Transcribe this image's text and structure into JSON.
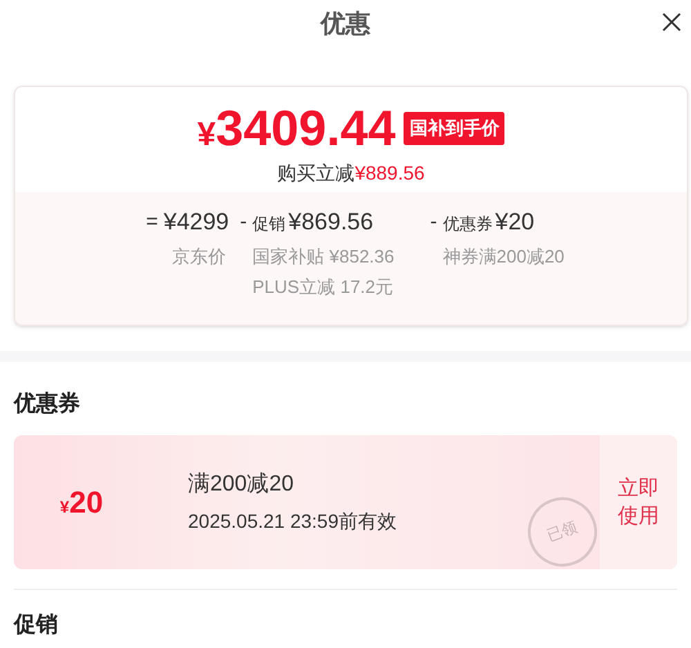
{
  "header": {
    "title": "优惠"
  },
  "summary": {
    "currency": "¥",
    "price": "3409.44",
    "price_badge": "国补到手价",
    "saving_label": "购买立减",
    "saving_amount": "¥889.56",
    "terms": [
      {
        "operator": "=",
        "amount": "¥4299",
        "details": [
          "京东价"
        ]
      },
      {
        "operator": "-",
        "label": "促销",
        "amount": "¥869.56",
        "details": [
          "国家补贴 ¥852.36",
          "PLUS立减 17.2元"
        ]
      },
      {
        "operator": "-",
        "label": "优惠券",
        "amount": "¥20",
        "details": [
          "神券满200减20"
        ]
      }
    ]
  },
  "coupon_section": {
    "title": "优惠券",
    "coupons": [
      {
        "currency": "¥",
        "amount": "20",
        "name": "满200减20",
        "validity": "2025.05.21 23:59前有效",
        "action": "立即使用",
        "stamp": "已领"
      }
    ]
  },
  "promotion_section": {
    "title": "促销"
  }
}
